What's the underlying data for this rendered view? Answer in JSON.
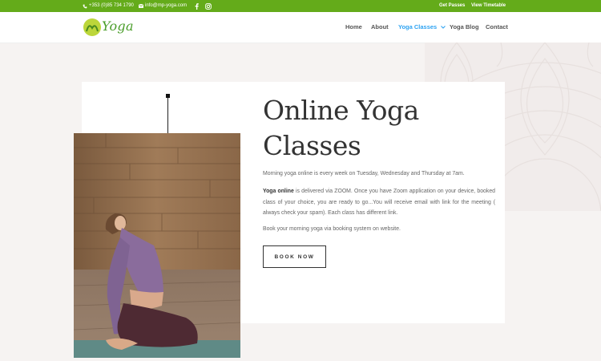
{
  "topbar": {
    "phone": "+353 (0)85 734 1790",
    "email": "info@mp-yoga.com",
    "links": [
      "Get Passes",
      "View Timetable"
    ],
    "icons": [
      "phone-icon",
      "envelope-icon",
      "facebook-icon",
      "instagram-icon"
    ]
  },
  "logo": {
    "mark": "MP",
    "text": "Yoga"
  },
  "nav": {
    "items": [
      "Home",
      "About",
      "Yoga Classes",
      "Yoga Blog",
      "Contact"
    ],
    "active": "Yoga Classes"
  },
  "hero": {
    "title": "Online Yoga Classes",
    "paragraph1": "Morning yoga online is every week on Tuesday, Wednesday and Thursday at 7am.",
    "paragraph2_bold": "Yoga online",
    "paragraph2_rest": " is delivered via ZOOM. Once you have Zoom application on your device, booked class of your choice, you are ready to go...You will receive email with link for the meeting ( always check your spam). Each class has different link.",
    "paragraph3": "Book your morning yoga via booking system on website.",
    "button": "BOOK NOW"
  },
  "colors": {
    "brand_green": "#64ab1a",
    "nav_active": "#2ea3f2",
    "title": "#333333",
    "background": "#f6f3f2"
  }
}
